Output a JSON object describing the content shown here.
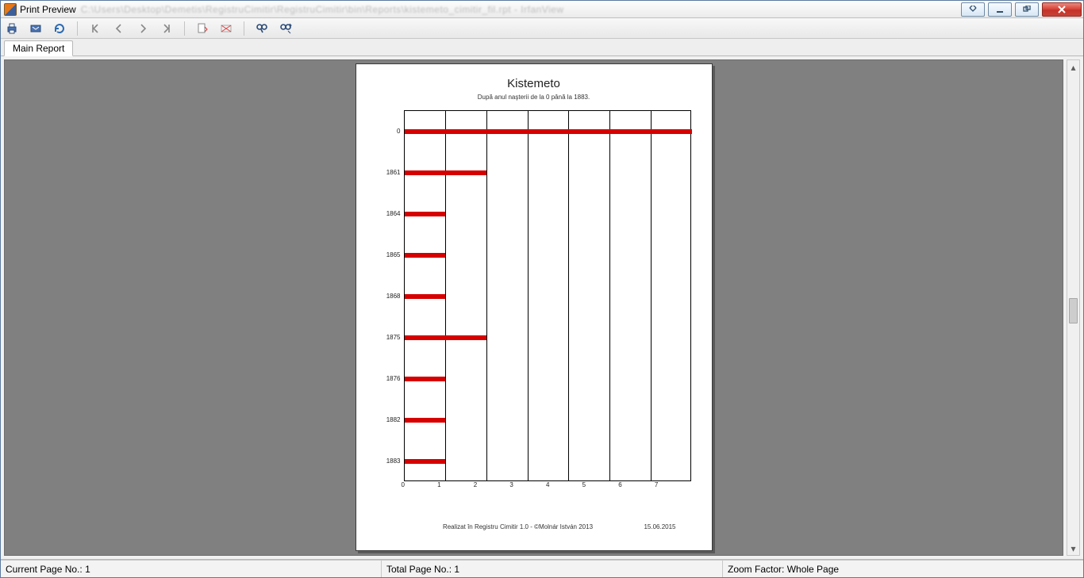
{
  "window": {
    "title": "Print Preview",
    "blurred_path": "C:\\Users\\Desktop\\Demetis\\RegistruCimitir\\RegistruCimitir\\bin\\Reports\\kistemeto_cimitir_fil.rpt - IrfanView"
  },
  "toolbar": {
    "icons": [
      "print",
      "export",
      "refresh",
      "first",
      "prev",
      "next",
      "last",
      "goto",
      "stop",
      "find",
      "find-options"
    ]
  },
  "tabs": {
    "main": "Main Report"
  },
  "status": {
    "current_label": "Current Page No.:",
    "current_value": "1",
    "total_label": "Total Page No.:",
    "total_value": "1",
    "zoom_label": "Zoom Factor:",
    "zoom_value": "Whole Page"
  },
  "report": {
    "title": "Kistemeto",
    "subtitle": "După anul naşterii de la 0 până la 1883.",
    "credit": "Realizat în Registru Cimitir 1.0 - ©Molnár István 2013",
    "date": "15.06.2015"
  },
  "chart_data": {
    "type": "bar",
    "orientation": "horizontal",
    "categories": [
      "0",
      "1861",
      "1864",
      "1865",
      "1868",
      "1875",
      "1876",
      "1882",
      "1883"
    ],
    "values": [
      7,
      2,
      1,
      1,
      1,
      2,
      1,
      1,
      1
    ],
    "xlim": [
      0,
      7
    ],
    "xlabel": "",
    "ylabel": "",
    "title": "Kistemeto",
    "x_ticks": [
      0,
      1,
      2,
      3,
      4,
      5,
      6,
      7
    ],
    "bar_color": "#d60000"
  }
}
